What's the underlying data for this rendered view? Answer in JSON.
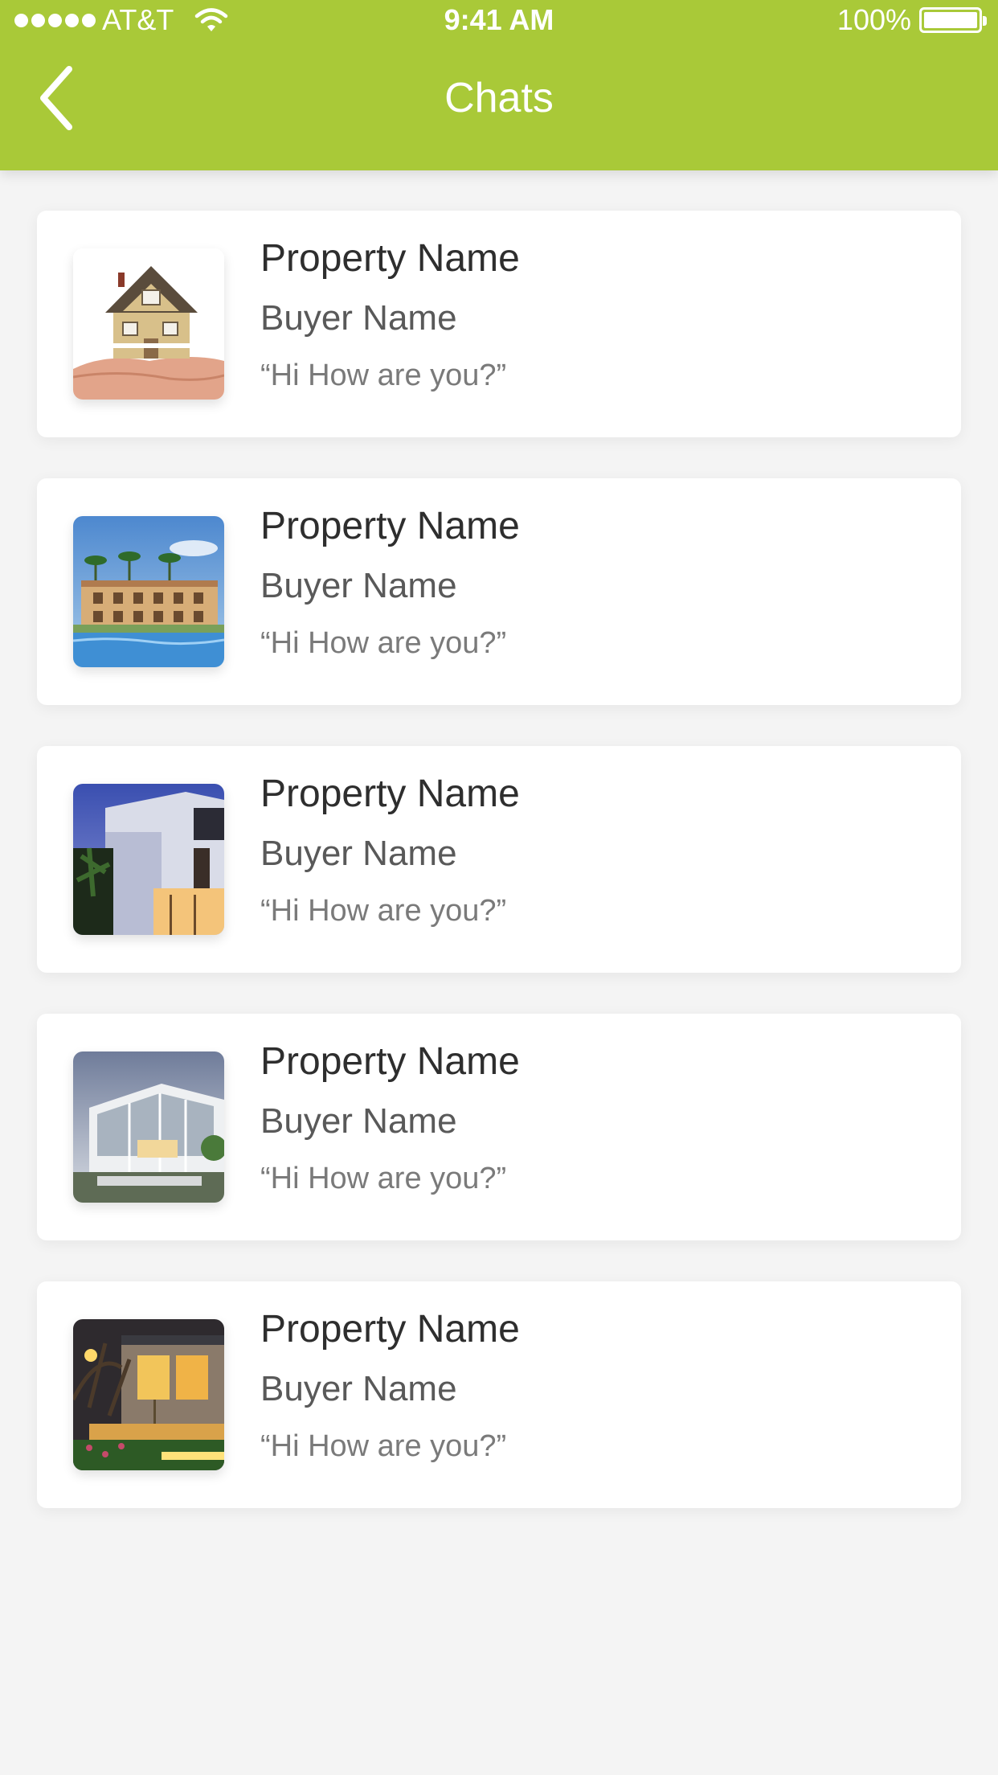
{
  "status_bar": {
    "carrier": "AT&T",
    "time": "9:41 AM",
    "battery": "100%"
  },
  "header": {
    "title": "Chats",
    "back_icon": "chevron-left-icon"
  },
  "colors": {
    "accent": "#a9c938",
    "background": "#f4f4f4",
    "card": "#ffffff"
  },
  "chats": [
    {
      "property": "Property Name",
      "buyer": "Buyer Name",
      "message": "“Hi How are you?”",
      "thumbnail": "house-in-hand-image"
    },
    {
      "property": "Property Name",
      "buyer": "Buyer Name",
      "message": "“Hi How are you?”",
      "thumbnail": "resort-pool-image"
    },
    {
      "property": "Property Name",
      "buyer": "Buyer Name",
      "message": "“Hi How are you?”",
      "thumbnail": "modern-house-dusk-image"
    },
    {
      "property": "Property Name",
      "buyer": "Buyer Name",
      "message": "“Hi How are you?”",
      "thumbnail": "glass-house-image"
    },
    {
      "property": "Property Name",
      "buyer": "Buyer Name",
      "message": "“Hi How are you?”",
      "thumbnail": "stone-house-night-image"
    }
  ]
}
